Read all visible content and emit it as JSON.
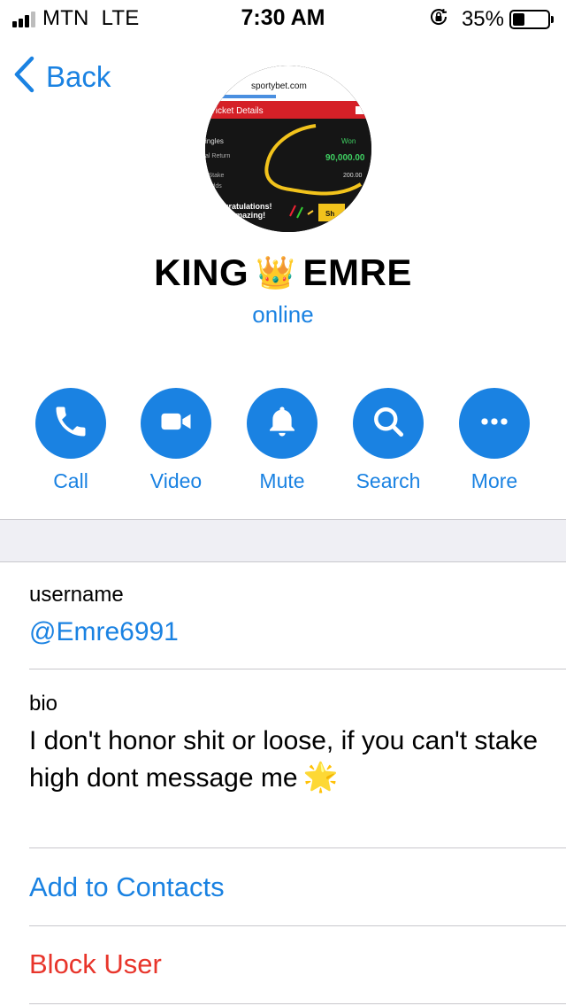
{
  "status_bar": {
    "carrier": "MTN",
    "network": "LTE",
    "time": "7:30 AM",
    "battery": "35%",
    "battery_level": 0.35
  },
  "nav": {
    "back_label": "Back"
  },
  "profile": {
    "name_first": "KING",
    "name_emoji": "👑",
    "name_last": "EMRE",
    "status": "online",
    "avatar_text": {
      "site": "sportybet.com",
      "header": "Ticket Details",
      "row1": "ingles",
      "won": "Won",
      "row2": "al Return",
      "amount": "90,000.00",
      "row3": "l Stake",
      "stake": "200.00",
      "row4": "Odds",
      "banner1": "ongratulations!",
      "banner2": "are Amazing!",
      "share": "Sh"
    }
  },
  "actions": [
    {
      "label": "Call",
      "icon": "phone-icon"
    },
    {
      "label": "Video",
      "icon": "video-camera-icon"
    },
    {
      "label": "Mute",
      "icon": "bell-icon"
    },
    {
      "label": "Search",
      "icon": "search-icon"
    },
    {
      "label": "More",
      "icon": "more-dots-icon"
    }
  ],
  "info": {
    "username_caption": "username",
    "username": "@Emre6991",
    "bio_caption": "bio",
    "bio": "I don't honor shit or loose, if you can't stake high dont message me",
    "bio_emoji": "🌟"
  },
  "options": {
    "add_contact": "Add to Contacts",
    "block_user": "Block User"
  },
  "colors": {
    "accent": "#1a82e2",
    "destructive": "#e8352b",
    "section_bg": "#efeff4"
  }
}
